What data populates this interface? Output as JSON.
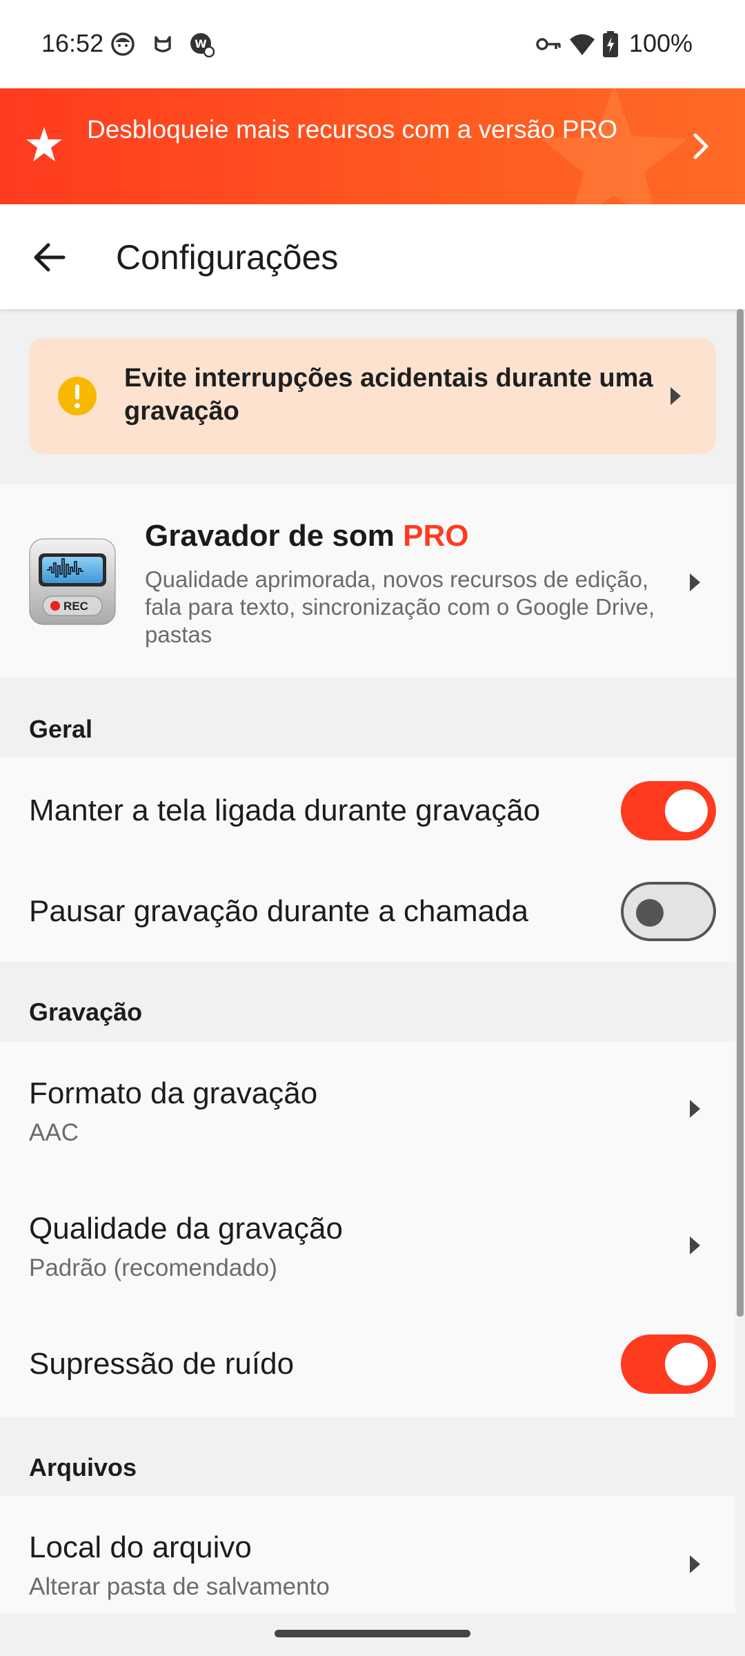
{
  "status_bar": {
    "time": "16:52",
    "battery": "100%",
    "icons": [
      "face-icon",
      "cat-icon",
      "vpn-badge-icon",
      "key-icon",
      "wifi-icon",
      "battery-charging-icon"
    ]
  },
  "promo": {
    "text": "Desbloqueie mais recursos com a versão PRO",
    "icon": "star-icon",
    "color": "#ff3b1f"
  },
  "appbar": {
    "title": "Configurações",
    "back_icon": "arrow-left-icon"
  },
  "alert": {
    "text": "Evite interrupções acidentais durante uma gravação",
    "icon": "warning-icon",
    "background": "#fde3cf"
  },
  "pro_card": {
    "title": "Gravador de som",
    "title_accent": "PRO",
    "subtitle": "Qualidade aprimorada, novos recursos de edição, fala para texto, sincronização com o Google Drive, pastas",
    "icon": "recorder-app-icon",
    "icon_label": "REC"
  },
  "sections": {
    "general": {
      "header": "Geral",
      "keep_screen_on": {
        "label": "Manter a tela ligada durante gravação",
        "enabled": true
      },
      "pause_on_call": {
        "label": "Pausar gravação durante a chamada",
        "enabled": false
      }
    },
    "recording": {
      "header": "Gravação",
      "format": {
        "label": "Formato da gravação",
        "value": "AAC"
      },
      "quality": {
        "label": "Qualidade da gravação",
        "value": "Padrão (recomendado)"
      },
      "noise_suppression": {
        "label": "Supressão de ruído",
        "enabled": true
      }
    },
    "files": {
      "header": "Arquivos",
      "location": {
        "label": "Local do arquivo",
        "value": "Alterar pasta de salvamento"
      }
    }
  },
  "colors": {
    "accent": "#ff3b1f",
    "switch_off_track": "#e3e3e3"
  }
}
